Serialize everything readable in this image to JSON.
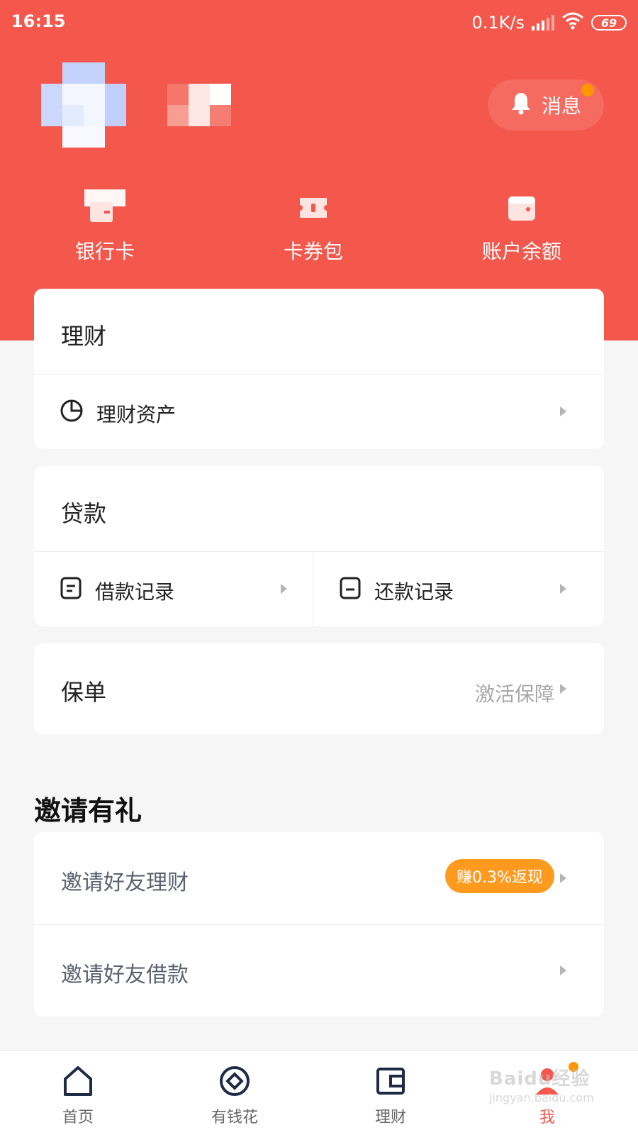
{
  "status_bar": {
    "time": "16:15",
    "net_speed": "0.1K/s",
    "battery": "69"
  },
  "header": {
    "message_label": "消息"
  },
  "quick_actions": [
    {
      "label": "银行卡",
      "icon": "bank-card-icon"
    },
    {
      "label": "卡券包",
      "icon": "coupon-icon"
    },
    {
      "label": "账户余额",
      "icon": "wallet-icon"
    }
  ],
  "finance_card": {
    "title": "理财",
    "item_label": "理财资产"
  },
  "loan_card": {
    "title": "贷款",
    "borrow_label": "借款记录",
    "repay_label": "还款记录"
  },
  "policy_card": {
    "title": "保单",
    "action_label": "激活保障"
  },
  "invite_section": {
    "title": "邀请有礼",
    "items": [
      {
        "label": "邀请好友理财",
        "badge": "赚0.3%返现"
      },
      {
        "label": "邀请好友借款"
      }
    ]
  },
  "bottom_nav": [
    {
      "label": "首页",
      "icon": "home-icon"
    },
    {
      "label": "有钱花",
      "icon": "money-circle-icon"
    },
    {
      "label": "理财",
      "icon": "finance-wallet-icon"
    },
    {
      "label": "我",
      "icon": "user-icon",
      "active": true
    }
  ],
  "watermark": {
    "main": "Baidu经验",
    "sub": "jingyan.baidu.com"
  },
  "colors": {
    "brand": "#f4574b",
    "badge": "#ff9a1f",
    "dot": "#ff9500"
  }
}
